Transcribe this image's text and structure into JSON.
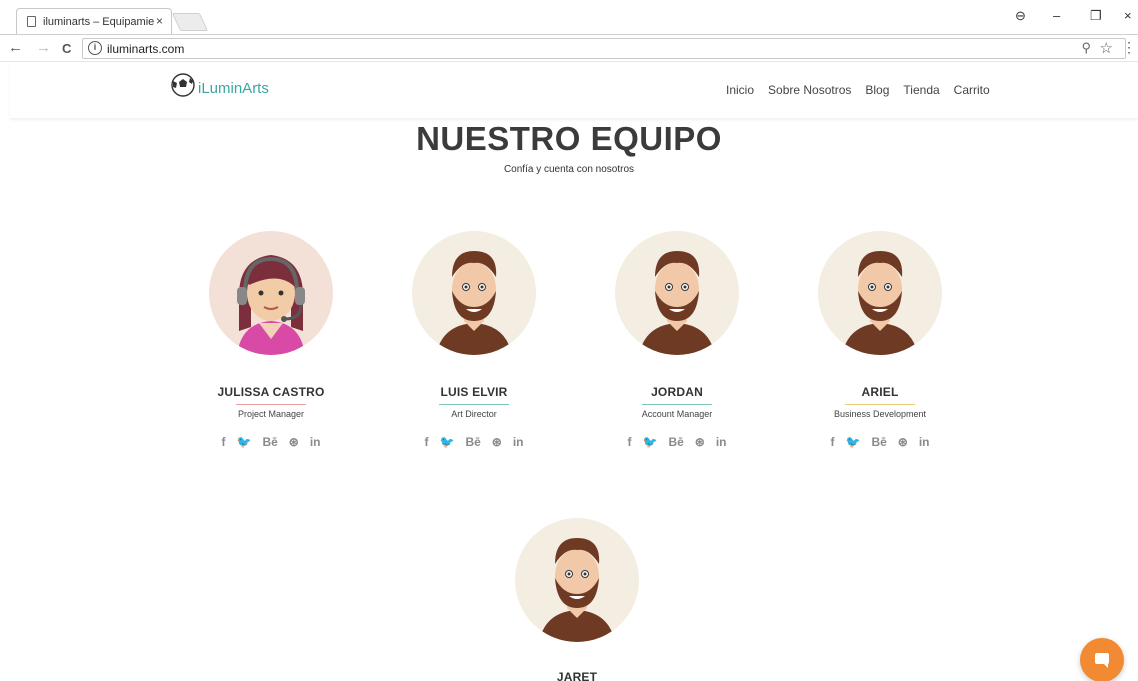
{
  "browser": {
    "tab_title": "iluminarts – Equipamient",
    "tab_close": "×",
    "url": "iluminarts.com",
    "back": "←",
    "forward": "→",
    "reload": "C",
    "info": "i",
    "zoom": "⚲",
    "star": "☆",
    "menu": "⋮",
    "profile": "⊖",
    "minimize": "–",
    "restore": "❐",
    "close": "×"
  },
  "site": {
    "logo_text": "iLuminArts",
    "nav": [
      "Inicio",
      "Sobre Nosotros",
      "Blog",
      "Tienda",
      "Carrito"
    ]
  },
  "section": {
    "title": "NUESTRO EQUIPO",
    "subtitle": "Confía y cuenta con nosotros"
  },
  "members": [
    {
      "name": "JULISSA CASTRO",
      "role": "Project Manager",
      "line_color": "#e8a0a0"
    },
    {
      "name": "LUIS ELVIR",
      "role": "Art Director",
      "line_color": "#7fc3b9"
    },
    {
      "name": "JORDAN",
      "role": "Account Manager",
      "line_color": "#7fc3b9"
    },
    {
      "name": "ARIEL",
      "role": "Business Development",
      "line_color": "#e9c97a"
    },
    {
      "name": "JARET",
      "role": "",
      "line_color": "#7fc3b9"
    }
  ],
  "socials": [
    "f",
    "🐦",
    "Bē",
    "⊛",
    "in"
  ],
  "colors": {
    "accent": "#f28a33",
    "logo": "#3aa7a0"
  }
}
